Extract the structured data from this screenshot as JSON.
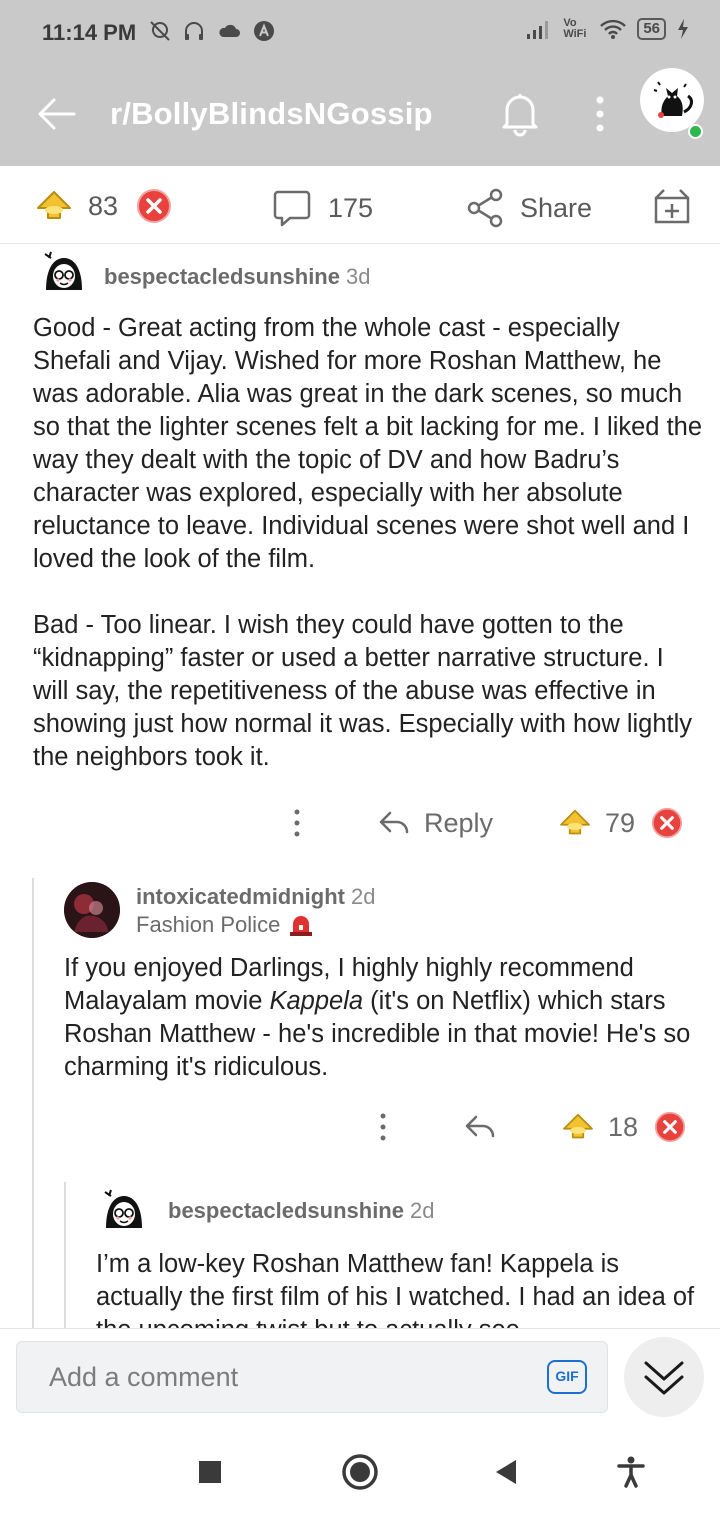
{
  "status_bar": {
    "time": "11:14 PM",
    "battery": "56",
    "wifi_label": "Vo WiFi"
  },
  "app_bar": {
    "subreddit": "r/BollyBlindsNGossip",
    "icons": [
      "back-arrow-icon",
      "bell-icon",
      "kebab-icon",
      "cat-avatar"
    ]
  },
  "post_actions": {
    "votes": "83",
    "comments": "175",
    "share": "Share"
  },
  "comments": [
    {
      "user": "bespectacledsunshine",
      "age": "3d",
      "paragraphs": [
        "Good - Great acting from the whole cast - especially Shefali and Vijay. Wished for more Roshan Matthew, he was adorable. Alia was great in the dark scenes, so much so that the lighter scenes felt a bit lacking for me. I liked the way they dealt with the topic of DV and how Badru’s character was explored, especially with her absolute reluctance to leave. Individual scenes were shot well and I loved the look of the film.",
        "Bad - Too linear. I wish they could have gotten to the “kidnapping” faster or used a better narrative structure. I will say, the repetitiveness of the abuse was effective in showing just how normal it was. Especially with how lightly the neighbors took it."
      ],
      "reply_label": "Reply",
      "votes": "79"
    },
    {
      "user": "intoxicatedmidnight",
      "age": "2d",
      "flair": "Fashion Police",
      "body_before": "If you enjoyed Darlings, I highly highly recommend Malayalam movie ",
      "body_italic": "Kappela",
      "body_after": " (it's on Netflix) which stars Roshan Matthew - he's incredible in that movie! He's so charming it's ridiculous.",
      "votes": "18"
    },
    {
      "user": "bespectacledsunshine",
      "age": "2d",
      "body": "I’m a low-key Roshan Matthew fan! Kappela is actually the first film of his I watched. I had an idea of the upcoming twist but to actually see"
    }
  ],
  "composer": {
    "placeholder": "Add a comment",
    "gif": "GIF"
  },
  "colors": {
    "header_bg": "#c9c9c9",
    "award_gold": "#f2c230",
    "downvote_red": "#e8423f",
    "gif_blue": "#1c6fd1"
  }
}
